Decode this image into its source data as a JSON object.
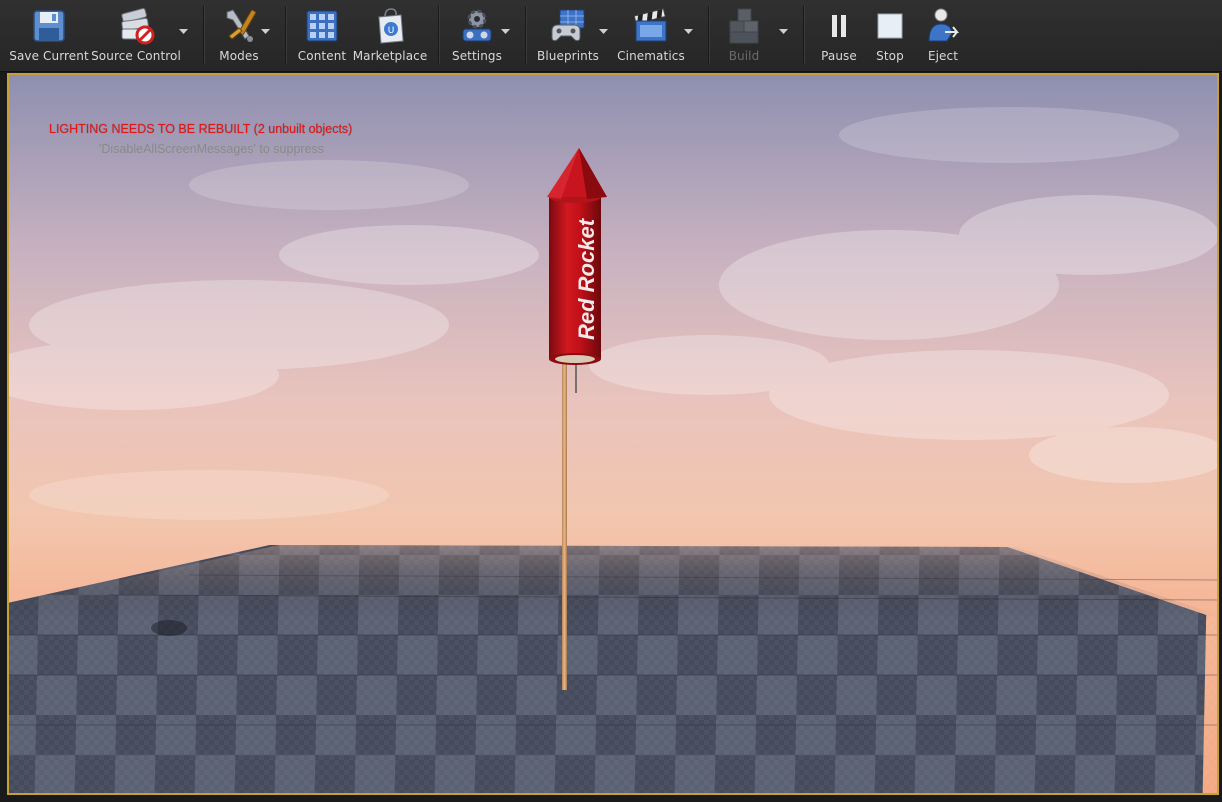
{
  "toolbar": {
    "save_current": "Save Current",
    "source_control": "Source Control",
    "modes": "Modes",
    "content": "Content",
    "marketplace": "Marketplace",
    "settings": "Settings",
    "blueprints": "Blueprints",
    "cinematics": "Cinematics",
    "build": "Build",
    "pause": "Pause",
    "stop": "Stop",
    "eject": "Eject"
  },
  "viewport": {
    "lighting_warning": "LIGHTING NEEDS TO BE REBUILT (2 unbuilt objects)",
    "suppress_hint": "'DisableAllScreenMessages' to suppress",
    "rocket_label": "Red Rocket"
  },
  "colors": {
    "viewport_border": "#c8a038",
    "warning_text": "#e01818",
    "rocket_red": "#c8141e"
  }
}
